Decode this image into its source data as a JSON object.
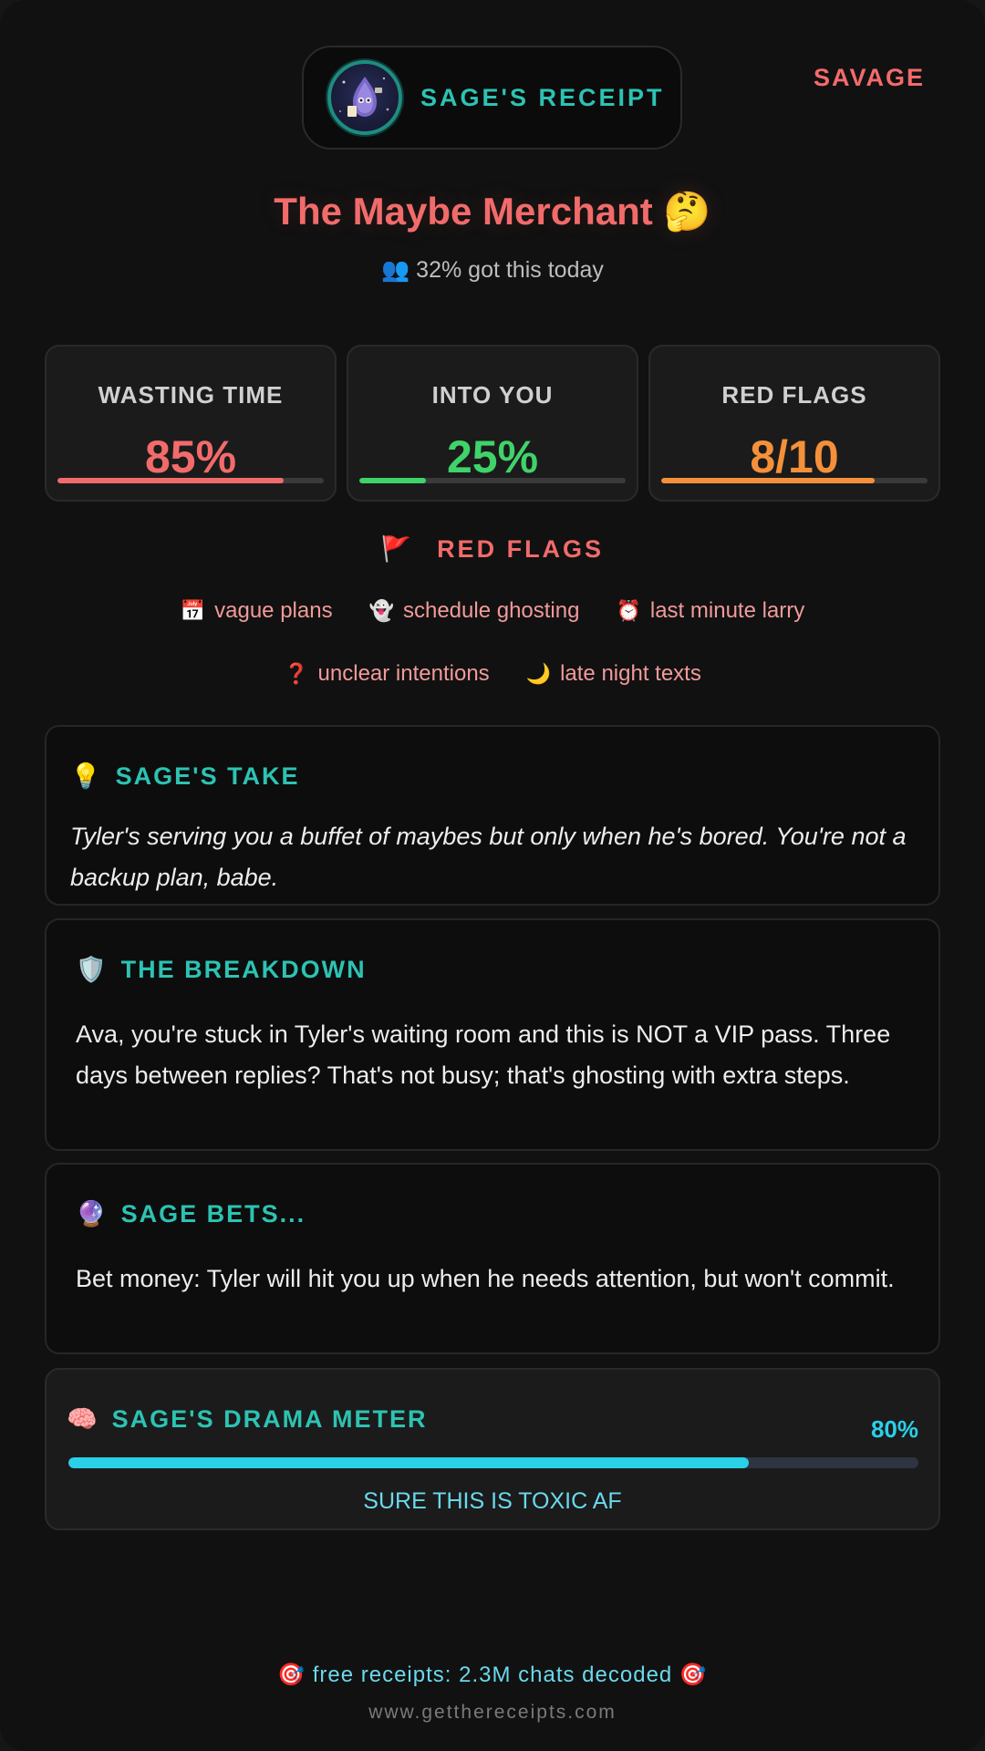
{
  "header": {
    "logo_text": "SAGE'S RECEIPT",
    "tone_label": "SAVAGE"
  },
  "result": {
    "title": "The Maybe Merchant 🤔",
    "subtitle": "👥 32% got this today"
  },
  "stats": [
    {
      "label": "WASTING TIME",
      "value": "85%",
      "level": 0.85,
      "color": "#f26b6b"
    },
    {
      "label": "INTO YOU",
      "value": "25%",
      "level": 0.25,
      "color": "#3fd36a"
    },
    {
      "label": "RED FLAGS",
      "value": "8/10",
      "level": 0.8,
      "color": "#f5903a"
    }
  ],
  "red_flags": {
    "heading": "RED FLAGS",
    "icon": "🚩",
    "items": [
      {
        "icon": "📅",
        "label": "vague plans"
      },
      {
        "icon": "👻",
        "label": "schedule ghosting"
      },
      {
        "icon": "⏰",
        "label": "last minute larry"
      },
      {
        "icon": "❓",
        "label": "unclear intentions"
      },
      {
        "icon": "🌙",
        "label": "late night texts"
      }
    ]
  },
  "sages_take": {
    "icon": "💡",
    "heading": "SAGE'S TAKE",
    "body": "Tyler's serving you a buffet of maybes but only when he's bored. You're not a backup plan, babe."
  },
  "breakdown": {
    "icon": "🛡️",
    "heading": "THE BREAKDOWN",
    "body": "Ava, you're stuck in Tyler's waiting room and this is NOT a VIP pass. Three days between replies? That's not busy; that's ghosting with extra steps."
  },
  "sage_bets": {
    "icon": "🔮",
    "heading": "SAGE BETS...",
    "body": "Bet money: Tyler will hit you up when he needs attention, but won't commit."
  },
  "drama_meter": {
    "icon": "🧠",
    "heading": "SAGE'S DRAMA METER",
    "value": "80%",
    "level": 0.8,
    "caption": "SURE THIS IS TOXIC AF"
  },
  "footer": {
    "line": "🎯 free receipts: 2.3M chats decoded 🎯",
    "url": "www.getthereceipts.com"
  },
  "colors": {
    "accent_teal": "#2cc3b3",
    "accent_red": "#f26b6b",
    "accent_cyan": "#2ad0e8"
  }
}
